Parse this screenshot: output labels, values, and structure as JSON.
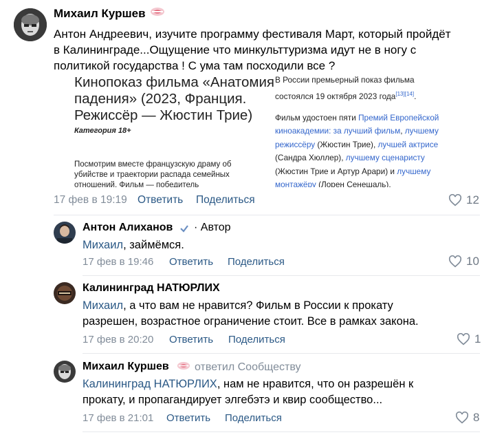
{
  "comments": [
    {
      "author": "Михаил Куршев",
      "text": "Антон Андреевич, изучите программу фестиваля Март, который пройдёт в Калининграде...Ощущение что минкульттуризма идут не в ногу с политикой государства ! С ума там посходили все ?",
      "text_lines": [
        "Антон Андреевич, изучите программу фестиваля Март, который пройдёт",
        "в Калининграде...Ощущение что минкульттуризма идут не в ногу с",
        "политикой государства ! С ума там посходили все ?"
      ],
      "date": "17 фев в 19:19",
      "reply_label": "Ответить",
      "share_label": "Поделиться",
      "likes": "12"
    },
    {
      "author": "Антон Алиханов",
      "author_suffix": "· Автор",
      "mention": "Михаил",
      "text": ", займёмся.",
      "date": "17 фев в 19:46",
      "reply_label": "Ответить",
      "share_label": "Поделиться",
      "likes": "10"
    },
    {
      "author": "Калининград НАТЮРЛИХ",
      "mention": "Михаил",
      "text_line1": ", а что вам не нравится? Фильм в России к прокату",
      "text_line2": "разрешен, возрастное ограничение стоит. Все в рамках закона.",
      "date": "17 фев в 20:20",
      "reply_label": "Ответить",
      "share_label": "Поделиться",
      "likes": "1"
    },
    {
      "author": "Михаил Куршев",
      "replied_to": "ответил Сообществу",
      "mention": "Калининград НАТЮРЛИХ",
      "text_line1": ", нам не нравится, что он разрешён к",
      "text_line2": "прокату, и пропагандирует элгебэтэ и квир сообщество...",
      "date": "17 фев в 21:01",
      "reply_label": "Ответить",
      "share_label": "Поделиться",
      "likes": "8"
    }
  ],
  "attachment": {
    "left": {
      "title_lines": [
        "Кинопоказ фильма «Анатомия",
        "падения» (2023, Франция.",
        "Режиссёр — Жюстин Трие)"
      ],
      "category": "Категория 18+",
      "body_lines": [
        "Посмотрим вместе французскую драму об",
        "убийстве и траектории распада семейных",
        "отношений. Фильм — победитель"
      ]
    },
    "right": {
      "p1_line1": "В России премьерный показ фильма",
      "p1_line2": "состоялся 19 октября 2023 года",
      "p1_refs": "[13][14]",
      "p1_end": ".",
      "l1a": "Фильм удостоен пяти ",
      "l1b": "Премий Европейской",
      "l2": "киноакадемии: за лучший фильм",
      "l2b": ", ",
      "l2c": "лучшему",
      "l3a": "режиссёру",
      "l3b": " (Жюстин Трие), ",
      "l3c": "лучшей актрисе",
      "l4a": "(Сандра Хюллер), ",
      "l4b": "лучшему сценаристу",
      "l5a": "(Жюстин Трие и Артур Арари) и ",
      "l5b": "лучшему",
      "l6a": "монтажёру",
      "l6b": " (Лорен Сенешаль)."
    }
  },
  "colors": {
    "link": "#2a5885",
    "meta": "#818c99",
    "verified": "#4a76a8",
    "emoji": "#e0566b"
  }
}
